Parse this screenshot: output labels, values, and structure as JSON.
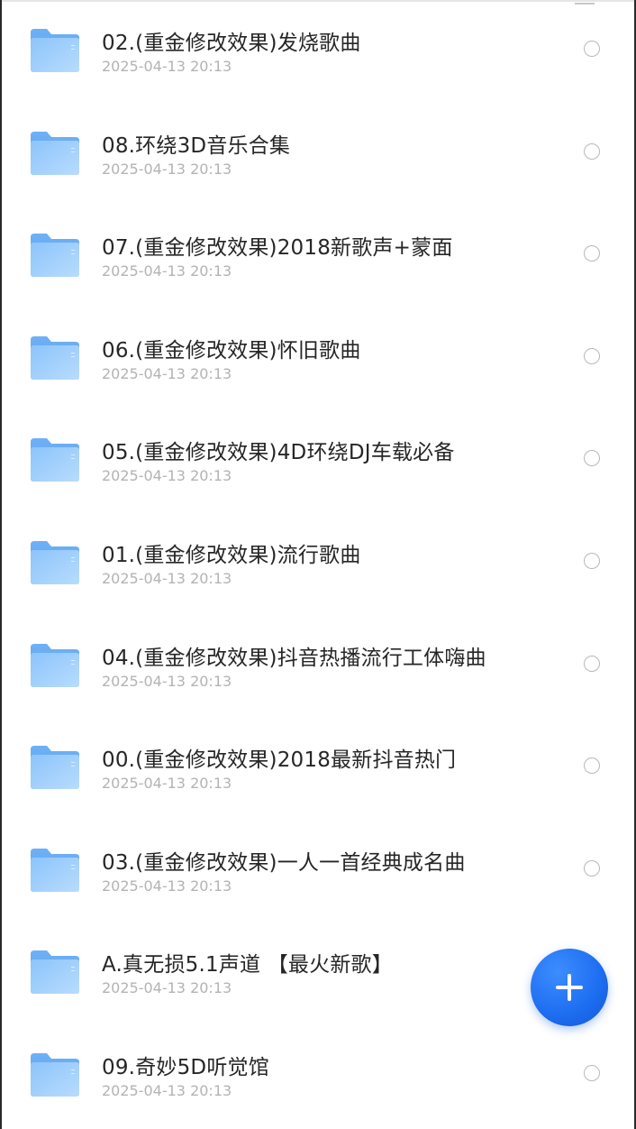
{
  "files": [
    {
      "name": "02.(重金修改效果)发烧歌曲",
      "date": "2025-04-13 20:13"
    },
    {
      "name": "08.环绕3D音乐合集",
      "date": "2025-04-13 20:13"
    },
    {
      "name": "07.(重金修改效果)2018新歌声+蒙面",
      "date": "2025-04-13 20:13"
    },
    {
      "name": "06.(重金修改效果)怀旧歌曲",
      "date": "2025-04-13 20:13"
    },
    {
      "name": "05.(重金修改效果)4D环绕DJ车载必备",
      "date": "2025-04-13 20:13"
    },
    {
      "name": "01.(重金修改效果)流行歌曲",
      "date": "2025-04-13 20:13"
    },
    {
      "name": "04.(重金修改效果)抖音热播流行工体嗨曲",
      "date": "2025-04-13 20:13"
    },
    {
      "name": "00.(重金修改效果)2018最新抖音热门",
      "date": "2025-04-13 20:13"
    },
    {
      "name": "03.(重金修改效果)一人一首经典成名曲",
      "date": "2025-04-13 20:13"
    },
    {
      "name": "A.真无损5.1声道 【最火新歌】",
      "date": "2025-04-13 20:13"
    },
    {
      "name": "09.奇妙5D听觉馆",
      "date": "2025-04-13 20:13"
    }
  ],
  "icons": {
    "folder": "folder-icon",
    "select": "radio-unchecked-icon",
    "fab": "plus-icon"
  },
  "colors": {
    "accent": "#1f6ff2",
    "folder_light": "#a9d2fb",
    "folder_dark": "#6fb0f5",
    "title_text": "#262626",
    "date_text": "#b3b3b3"
  }
}
